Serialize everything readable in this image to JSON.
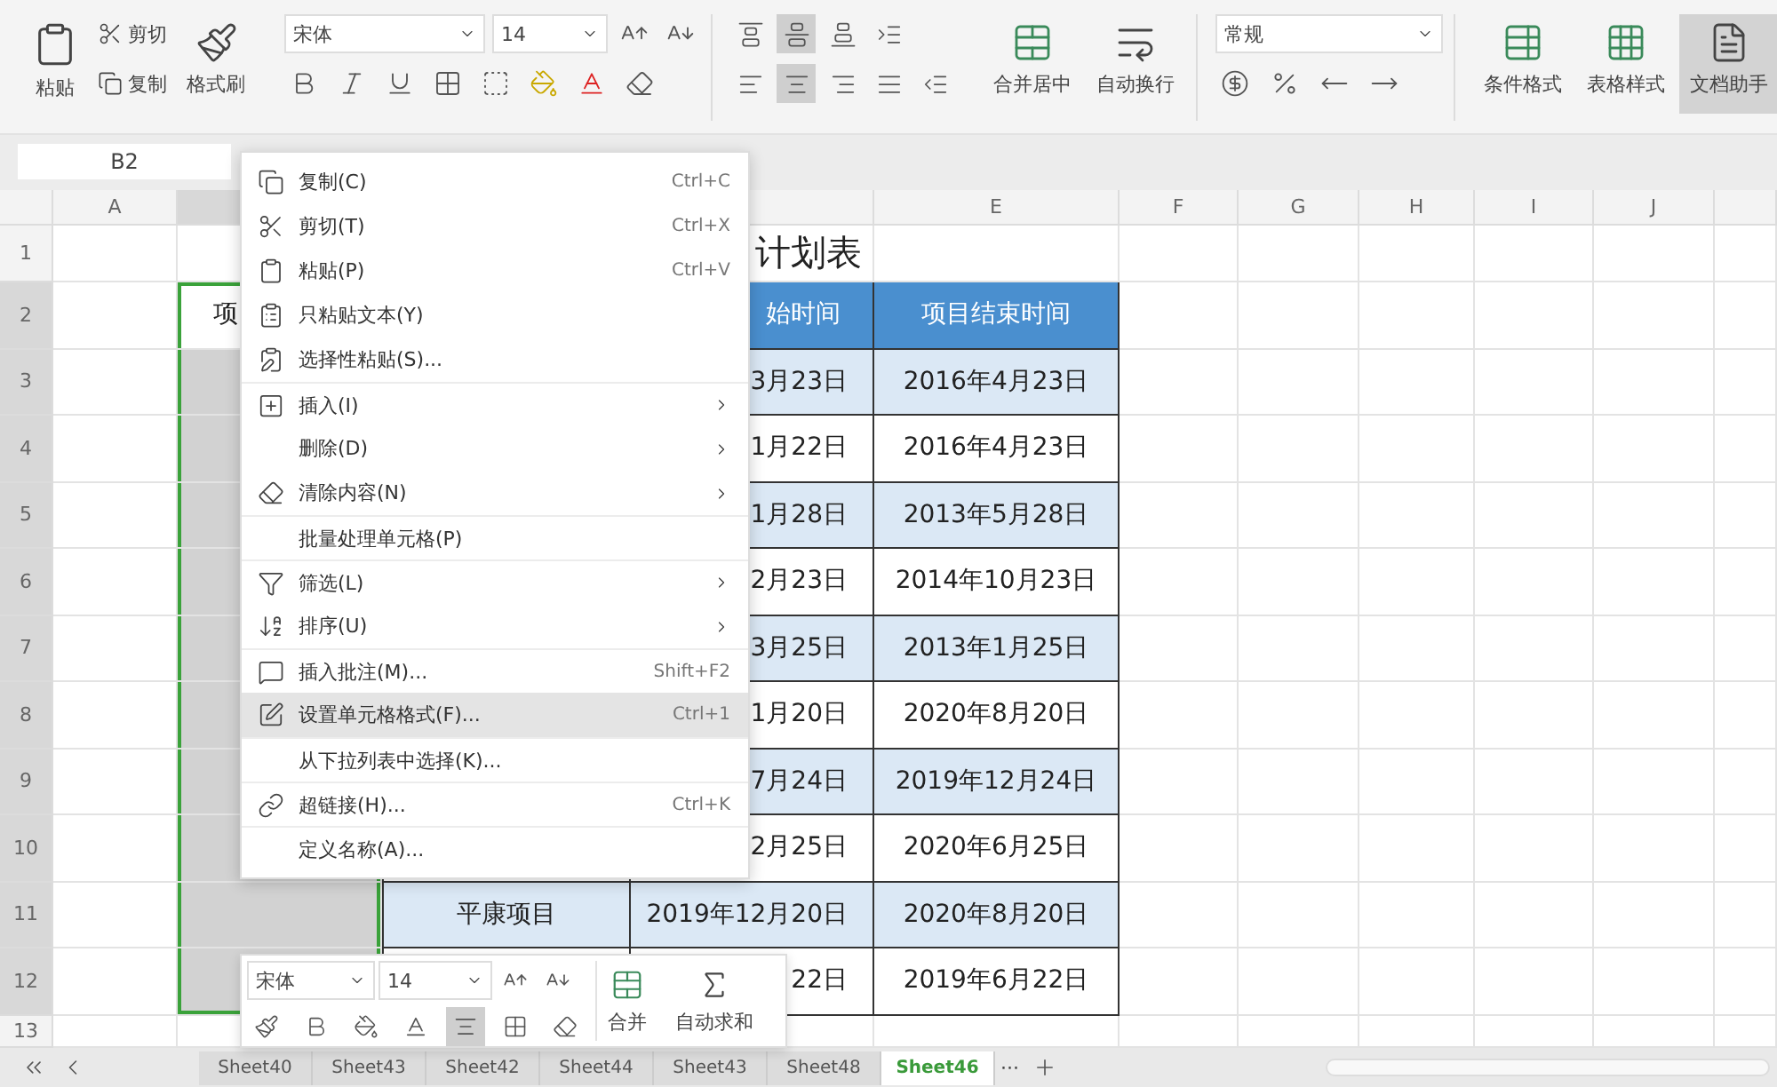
{
  "ribbon": {
    "paste": "粘贴",
    "cut": "剪切",
    "copy": "复制",
    "format_painter": "格式刷",
    "font": "宋体",
    "font_size": "14",
    "align_top": [
      {
        "kind": "top",
        "selected": false
      },
      {
        "kind": "middle",
        "selected": true
      },
      {
        "kind": "bottom",
        "selected": false
      },
      {
        "kind": "indent",
        "selected": false
      }
    ],
    "align_bottom": [
      {
        "kind": "left",
        "selected": false
      },
      {
        "kind": "center",
        "selected": true
      },
      {
        "kind": "right",
        "selected": false
      },
      {
        "kind": "justify",
        "selected": false
      },
      {
        "kind": "outdent",
        "selected": false
      }
    ],
    "merge_center": "合并居中",
    "wrap_text": "自动换行",
    "number_format": "常规",
    "conditional_format": "条件格式",
    "table_style": "表格样式",
    "assistant": {
      "label": "文档助手",
      "selected": true
    }
  },
  "name_box": "B2",
  "columns": [
    {
      "label": "A",
      "selected": false
    },
    {
      "selected": true
    },
    {},
    {},
    {
      "label": "E",
      "selected": false
    },
    {
      "label": "F",
      "selected": false
    },
    {
      "label": "G",
      "selected": false
    },
    {
      "label": "H",
      "selected": false
    },
    {
      "label": "I",
      "selected": false
    },
    {
      "label": "J",
      "selected": false
    }
  ],
  "rows": [
    {
      "label": "1",
      "selected": false,
      "kind": "title",
      "text": "计划表"
    },
    {
      "label": "2",
      "selected": true,
      "kind": "header",
      "b": "项",
      "d": "始时间",
      "e": "项目结束时间"
    },
    {
      "label": "3",
      "selected": true,
      "kind": "data",
      "d": "3月23日",
      "e": "2016年4月23日"
    },
    {
      "label": "4",
      "selected": true,
      "kind": "data",
      "d": "1月22日",
      "e": "2016年4月23日"
    },
    {
      "label": "5",
      "selected": true,
      "kind": "data",
      "d": "1月28日",
      "e": "2013年5月28日"
    },
    {
      "label": "6",
      "selected": true,
      "kind": "data",
      "d": "2月23日",
      "e": "2014年10月23日"
    },
    {
      "label": "7",
      "selected": true,
      "kind": "data",
      "d": "3月25日",
      "e": "2013年1月25日"
    },
    {
      "label": "8",
      "selected": true,
      "kind": "data",
      "d": "1月20日",
      "e": "2020年8月20日"
    },
    {
      "label": "9",
      "selected": true,
      "kind": "data",
      "d": "7月24日",
      "e": "2019年12月24日"
    },
    {
      "label": "10",
      "selected": true,
      "kind": "data",
      "d": "2月25日",
      "e": "2020年6月25日"
    },
    {
      "label": "11",
      "selected": true,
      "kind": "data",
      "c": "平康项目",
      "d": "2019年12月20日",
      "e": "2020年8月20日"
    },
    {
      "label": "12",
      "selected": true,
      "kind": "data",
      "d": "22日",
      "e": "2019年6月22日"
    },
    {
      "label": "13",
      "selected": false,
      "kind": "empty"
    }
  ],
  "context_menu": [
    {
      "kind": "copy",
      "label": "复制(C)",
      "shortcut": "Ctrl+C",
      "submenu": false,
      "separator_before": false,
      "highlighted": false
    },
    {
      "kind": "cut",
      "label": "剪切(T)",
      "shortcut": "Ctrl+X",
      "submenu": false,
      "separator_before": false,
      "highlighted": false
    },
    {
      "kind": "paste",
      "label": "粘贴(P)",
      "shortcut": "Ctrl+V",
      "submenu": false,
      "separator_before": false,
      "highlighted": false
    },
    {
      "kind": "paste_text",
      "label": "只粘贴文本(Y)",
      "submenu": false,
      "separator_before": false,
      "highlighted": false
    },
    {
      "kind": "paste_special",
      "label": "选择性粘贴(S)...",
      "submenu": false,
      "separator_before": false,
      "highlighted": false
    },
    {
      "kind": "insert",
      "label": "插入(I)",
      "submenu": true,
      "separator_before": true,
      "highlighted": false
    },
    {
      "kind": "plain",
      "label": "删除(D)",
      "submenu": true,
      "separator_before": false,
      "highlighted": false
    },
    {
      "kind": "clear",
      "label": "清除内容(N)",
      "submenu": true,
      "separator_before": false,
      "highlighted": false
    },
    {
      "kind": "plain",
      "label": "批量处理单元格(P)",
      "submenu": false,
      "separator_before": true,
      "highlighted": false
    },
    {
      "kind": "filter",
      "label": "筛选(L)",
      "submenu": true,
      "separator_before": true,
      "highlighted": false
    },
    {
      "kind": "sort",
      "label": "排序(U)",
      "submenu": true,
      "separator_before": false,
      "highlighted": false
    },
    {
      "kind": "comment",
      "label": "插入批注(M)...",
      "shortcut": "Shift+F2",
      "submenu": false,
      "separator_before": true,
      "highlighted": false
    },
    {
      "kind": "format",
      "label": "设置单元格格式(F)...",
      "shortcut": "Ctrl+1",
      "submenu": false,
      "separator_before": false,
      "highlighted": true
    },
    {
      "kind": "plain",
      "label": "从下拉列表中选择(K)...",
      "submenu": false,
      "separator_before": true,
      "highlighted": false
    },
    {
      "kind": "link",
      "label": "超链接(H)...",
      "shortcut": "Ctrl+K",
      "submenu": false,
      "separator_before": true,
      "highlighted": false
    },
    {
      "kind": "plain",
      "label": "定义名称(A)...",
      "submenu": false,
      "separator_before": true,
      "highlighted": false
    }
  ],
  "mini_toolbar": {
    "font": "宋体",
    "font_size": "14",
    "merge": "合并",
    "autosum": "自动求和",
    "buttons": [
      {
        "kind": "painter",
        "selected": false
      },
      {
        "kind": "bold",
        "selected": false
      },
      {
        "kind": "fill",
        "selected": false
      },
      {
        "kind": "font_color",
        "selected": false
      },
      {
        "kind": "align",
        "selected": true
      },
      {
        "kind": "border",
        "selected": false
      },
      {
        "kind": "eraser",
        "selected": false
      }
    ]
  },
  "sheet_tabs": [
    {
      "label": "Sheet40",
      "selected": false
    },
    {
      "label": "Sheet43",
      "selected": false
    },
    {
      "label": "Sheet42",
      "selected": false
    },
    {
      "label": "Sheet44",
      "selected": false
    },
    {
      "label": "Sheet43",
      "selected": false
    },
    {
      "label": "Sheet48",
      "selected": false
    },
    {
      "label": "Sheet46",
      "selected": true
    }
  ],
  "more_tabs": "···"
}
